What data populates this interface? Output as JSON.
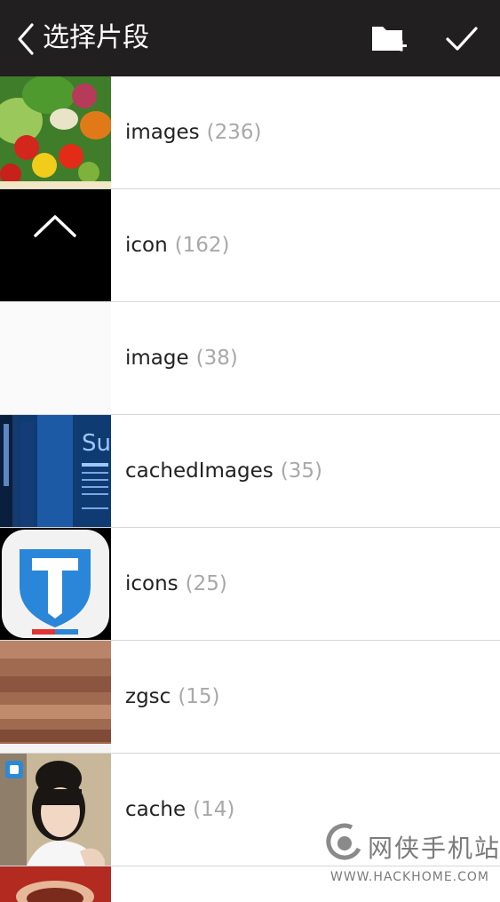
{
  "header": {
    "title": "选择片段",
    "back_icon": "chevron-left-icon",
    "new_folder_icon": "folder-add-icon",
    "confirm_icon": "checkmark-icon"
  },
  "folders": [
    {
      "name": "images",
      "count": "(236)"
    },
    {
      "name": "icon",
      "count": "(162)"
    },
    {
      "name": "image",
      "count": "(38)"
    },
    {
      "name": "cachedImages",
      "count": "(35)"
    },
    {
      "name": "icons",
      "count": "(25)"
    },
    {
      "name": "zgsc",
      "count": "(15)"
    },
    {
      "name": "cache",
      "count": "(14)"
    }
  ],
  "watermark": {
    "cn": "网侠手机站",
    "en": "WWW.HACKHOME.COM"
  },
  "colors": {
    "header_bg": "#221f20",
    "divider": "#d7d7d7",
    "count_text": "#a8a8a8"
  }
}
